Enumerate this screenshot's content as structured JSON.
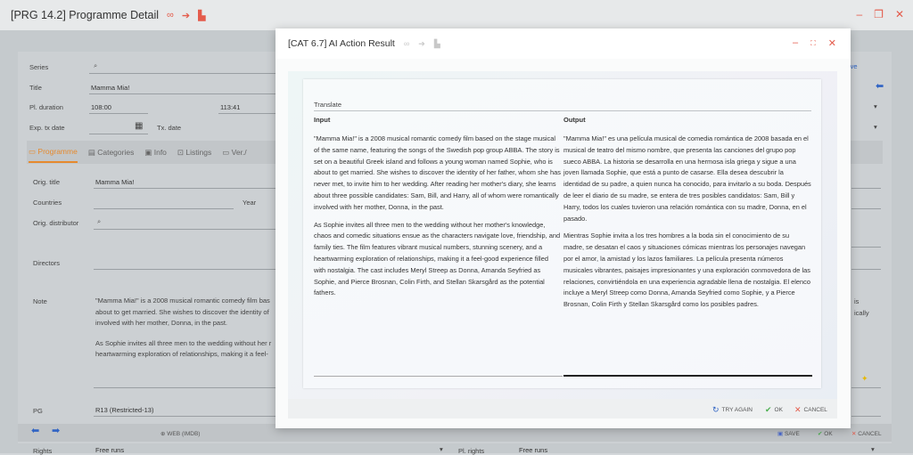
{
  "window": {
    "title": "[PRG 14.2] Programme Detail",
    "controls": [
      "–",
      "❐",
      "✕"
    ]
  },
  "form": {
    "series_label": "Series",
    "title_label": "Title",
    "title_value": "Mamma Mia!",
    "duration_label": "Pl. duration",
    "duration_value": "108:00",
    "duration_value2": "113:41",
    "tx_date_label": "Exp. tx date",
    "tx_date_label2": "Tx. date",
    "right_link": "ive"
  },
  "tabs": [
    {
      "label": "Programme",
      "active": true
    },
    {
      "label": "Categories"
    },
    {
      "label": "Info"
    },
    {
      "label": "Listings"
    },
    {
      "label": "Ver./"
    }
  ],
  "programme": {
    "orig_title_label": "Orig. title",
    "orig_title_value": "Mamma Mia!",
    "countries_label": "Countries",
    "year_label": "Year",
    "distributor_label": "Orig. distributor",
    "directors_label": "Directors",
    "note_label": "Note",
    "note_text_1": "\"Mamma Mia!\" is a 2008 musical romantic comedy film bas",
    "note_text_2": "about to get married. She wishes to discover the identity of",
    "note_text_3": "involved with her mother, Donna, in the past.",
    "note_text_4": "As Sophie invites all three men to the wedding without her r",
    "note_text_5": "heartwarming exploration of relationships, making it a feel-",
    "note_right_1": "is",
    "note_right_2": "ically",
    "pg_label": "PG",
    "pg_value": "R13 (Restricted-13)",
    "rights_label": "Rights",
    "rights_value": "Free runs",
    "pl_rights_label": "Pl. rights",
    "pl_rights_value": "Free runs"
  },
  "bottom_bar": {
    "web_label": "WEB (IMDB)",
    "save_label": "SAVE",
    "ok_label": "OK",
    "cancel_label": "CANCEL"
  },
  "modal": {
    "title": "[CAT 6.7] AI Action Result",
    "card_label": "Translate",
    "input_header": "Input",
    "output_header": "Output",
    "input_p1": "\"Mamma Mia!\" is a 2008 musical romantic comedy film based on the stage musical of the same name, featuring the songs of the Swedish pop group ABBA. The story is set on a beautiful Greek island and follows a young woman named Sophie, who is about to get married. She wishes to discover the identity of her father, whom she has never met, to invite him to her wedding. After reading her mother's diary, she learns about three possible candidates: Sam, Bill, and Harry, all of whom were romantically involved with her mother, Donna, in the past.",
    "input_p2": "As Sophie invites all three men to the wedding without her mother's knowledge, chaos and comedic situations ensue as the characters navigate love, friendship, and family ties. The film features vibrant musical numbers, stunning scenery, and a heartwarming exploration of relationships, making it a feel-good experience filled with nostalgia. The cast includes Meryl Streep as Donna, Amanda Seyfried as Sophie, and Pierce Brosnan, Colin Firth, and Stellan Skarsgård as the potential fathers.",
    "output_p1": "\"Mamma Mia!\" es una película musical de comedia romántica de 2008 basada en el musical de teatro del mismo nombre, que presenta las canciones del grupo pop sueco ABBA. La historia se desarrolla en una hermosa isla griega y sigue a una joven llamada Sophie, que está a punto de casarse. Ella desea descubrir la identidad de su padre, a quien nunca ha conocido, para invitarlo a su boda. Después de leer el diario de su madre, se entera de tres posibles candidatos: Sam, Bill y Harry, todos los cuales tuvieron una relación romántica con su madre, Donna, en el pasado.",
    "output_p2": "Mientras Sophie invita a los tres hombres a la boda sin el conocimiento de su madre, se desatan el caos y situaciones cómicas mientras los personajes navegan por el amor, la amistad y los lazos familiares. La película presenta números musicales vibrantes, paisajes impresionantes y una exploración conmovedora de las relaciones, convirtiéndola en una experiencia agradable llena de nostalgia. El elenco incluye a Meryl Streep como Donna, Amanda Seyfried como Sophie, y a Pierce Brosnan, Colin Firth y Stellan Skarsgård como los posibles padres.",
    "try_again_label": "TRY AGAIN",
    "ok_label": "OK",
    "cancel_label": "CANCEL"
  },
  "colors": {
    "accent": "#e68a2e",
    "danger": "#e45b4b",
    "success": "#4caf50",
    "link": "#2f63c4"
  }
}
